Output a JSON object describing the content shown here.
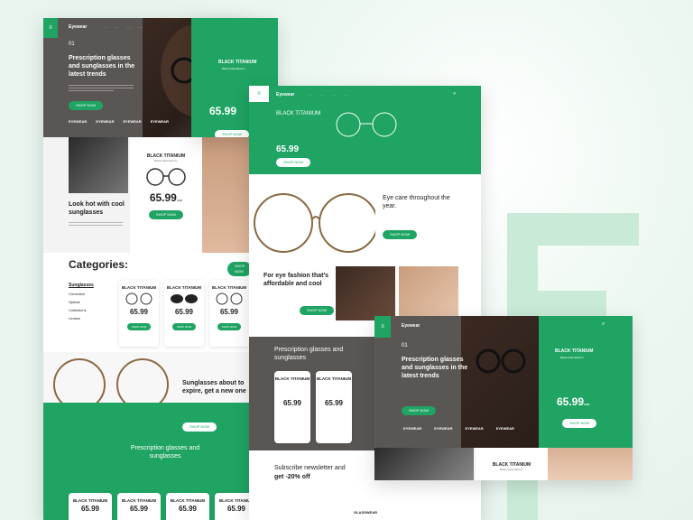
{
  "brand": "Eyewear",
  "hero": {
    "slide": "01",
    "title": "Prescription glasses and sunglasses in the latest trends",
    "button": "SHOP NOW",
    "brands": [
      "EYEWEAR",
      "EYEWEAR",
      "EYEWEAR",
      "EYEWEAR"
    ],
    "brands_short": [
      "EYEWEAR",
      "EYEWEAR",
      "EYEWEAR",
      "EYEWEAR"
    ]
  },
  "product": {
    "name": "BLACK TITANIUM",
    "subtitle": "Black solid titanium",
    "price": "65.99",
    "currency": "USD",
    "button": "SHOP NOW"
  },
  "promo": {
    "title": "Look hot with cool sunglasses",
    "button": "SHOP NOW"
  },
  "categories": {
    "title": "Categories:",
    "items": [
      "Sunglasses",
      "Corrective",
      "Optical",
      "Collections",
      "Lenses"
    ],
    "button": "SHOP NOW"
  },
  "expire": {
    "title": "Sunglasses about to expire, get a new one",
    "button": "SHOP NOW"
  },
  "prescription": {
    "title": "Prescription glasses and sunglasses"
  },
  "eyecare": {
    "title": "Eye care throughout the year.",
    "button": "SHOP NOW"
  },
  "fashion": {
    "title": "For eye fashion that's affordable and cool",
    "button": "SHOP NOW"
  },
  "newsletter": {
    "title": "Subscribe newsletter and",
    "highlight": "get -20% off"
  },
  "footer": {
    "brand": "GLASSWEAR"
  },
  "colors": {
    "accent": "#1fa463",
    "dark": "#5a5654"
  }
}
